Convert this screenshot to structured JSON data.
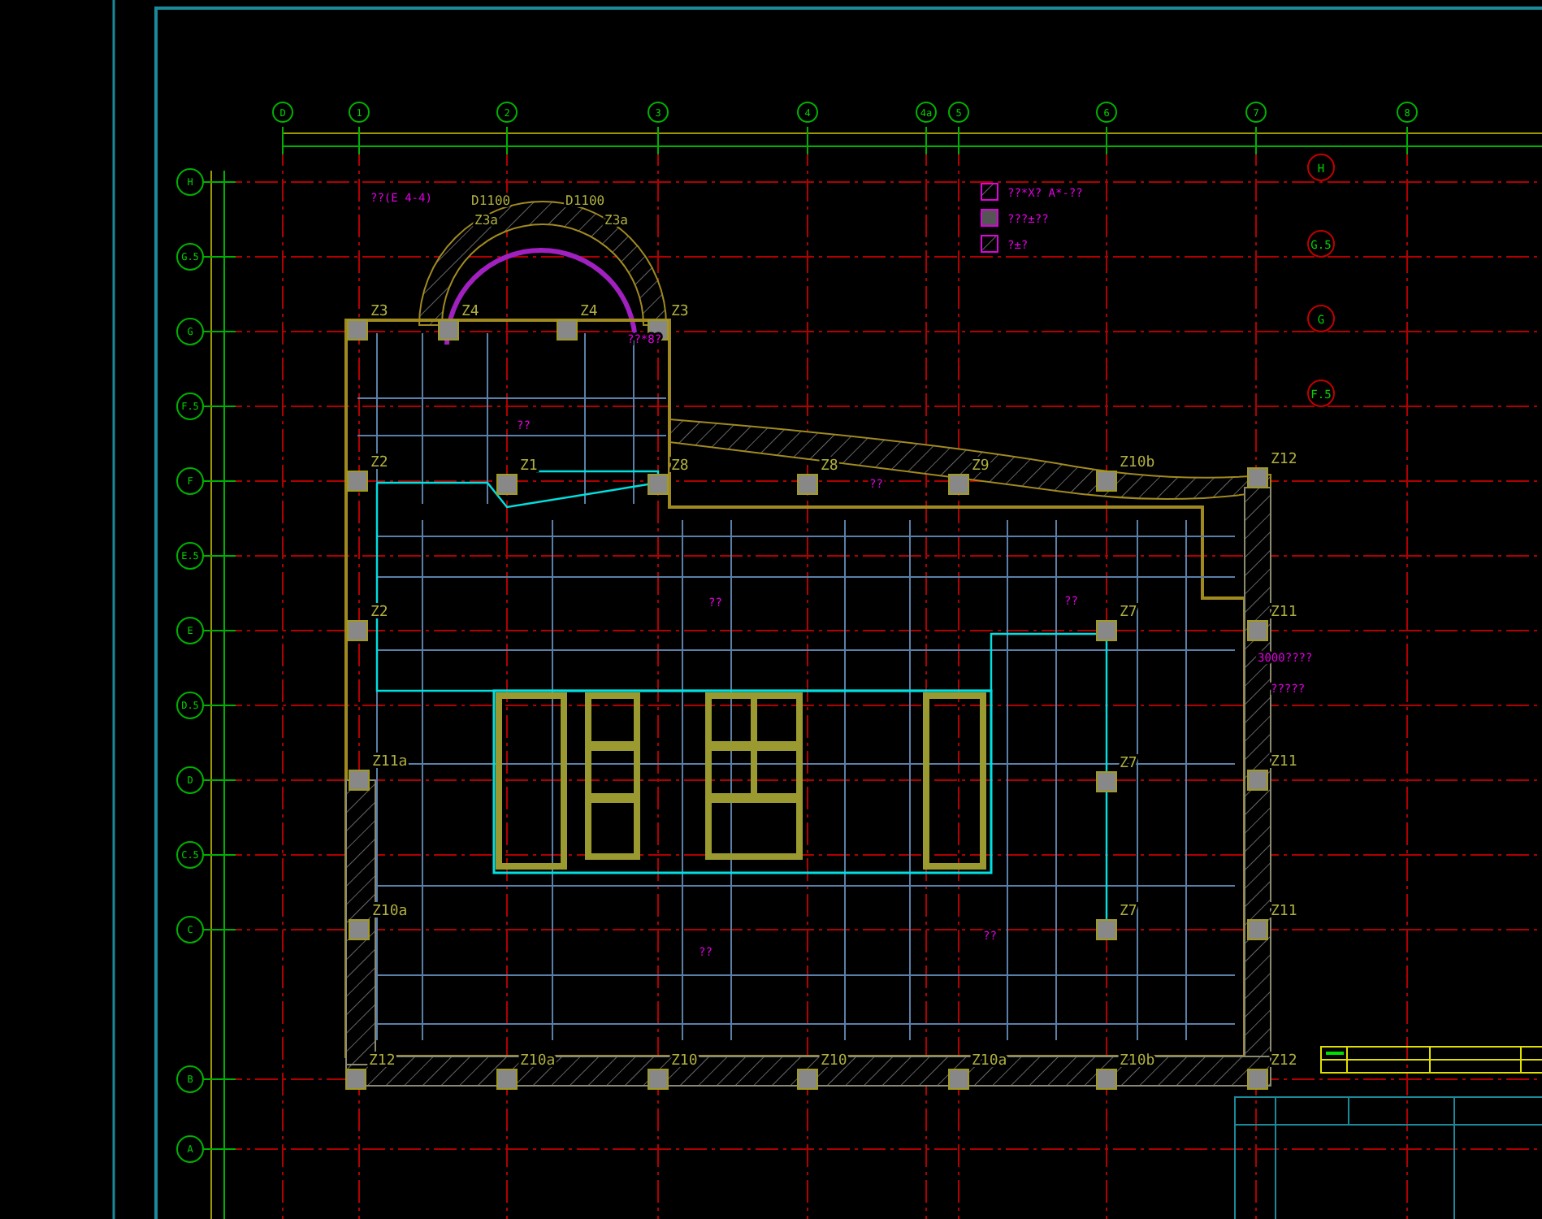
{
  "drawing": {
    "top_axes": [
      "D",
      "1",
      "2",
      "3",
      "4",
      "4a",
      "5",
      "6",
      "7",
      "8"
    ],
    "left_axes": [
      "H",
      "G.5",
      "G",
      "F.5",
      "F",
      "E.5",
      "E",
      "D.5",
      "D",
      "C.5",
      "C",
      "B",
      "A"
    ],
    "right_axes": [
      "H",
      "G.5",
      "G",
      "F.5"
    ],
    "columns": [
      {
        "label": "Z3"
      },
      {
        "label": "Z4"
      },
      {
        "label": "Z4"
      },
      {
        "label": "Z3"
      },
      {
        "label": "Z2"
      },
      {
        "label": "Z1"
      },
      {
        "label": "Z8"
      },
      {
        "label": "Z8"
      },
      {
        "label": "Z9"
      },
      {
        "label": "Z10b"
      },
      {
        "label": "Z12"
      },
      {
        "label": "Z2"
      },
      {
        "label": "Z7"
      },
      {
        "label": "Z11"
      },
      {
        "label": "Z11a"
      },
      {
        "label": "Z7"
      },
      {
        "label": "Z11"
      },
      {
        "label": "Z10a"
      },
      {
        "label": "Z7"
      },
      {
        "label": "Z11"
      },
      {
        "label": "Z12"
      },
      {
        "label": "Z10a"
      },
      {
        "label": "Z10"
      },
      {
        "label": "Z10"
      },
      {
        "label": "Z10a"
      },
      {
        "label": "Z10b"
      },
      {
        "label": "Z12"
      }
    ],
    "annotations": [
      {
        "kind": "tag",
        "text": "D1100"
      },
      {
        "kind": "tag",
        "text": "D1100"
      },
      {
        "kind": "tag",
        "text": "Z3a"
      },
      {
        "kind": "tag",
        "text": "Z3a"
      },
      {
        "kind": "note",
        "text": "??(E 4-4)"
      },
      {
        "kind": "note",
        "text": "??*8?"
      },
      {
        "kind": "note",
        "text": "??"
      },
      {
        "kind": "note",
        "text": "??"
      },
      {
        "kind": "note",
        "text": "??"
      },
      {
        "kind": "note",
        "text": "??"
      },
      {
        "kind": "note",
        "text": "??"
      },
      {
        "kind": "note",
        "text": "??"
      },
      {
        "kind": "note",
        "text": "3000????"
      },
      {
        "kind": "note",
        "text": "?????"
      }
    ],
    "legend": [
      "??*X? A*-??",
      "???±??",
      "?±?"
    ]
  }
}
